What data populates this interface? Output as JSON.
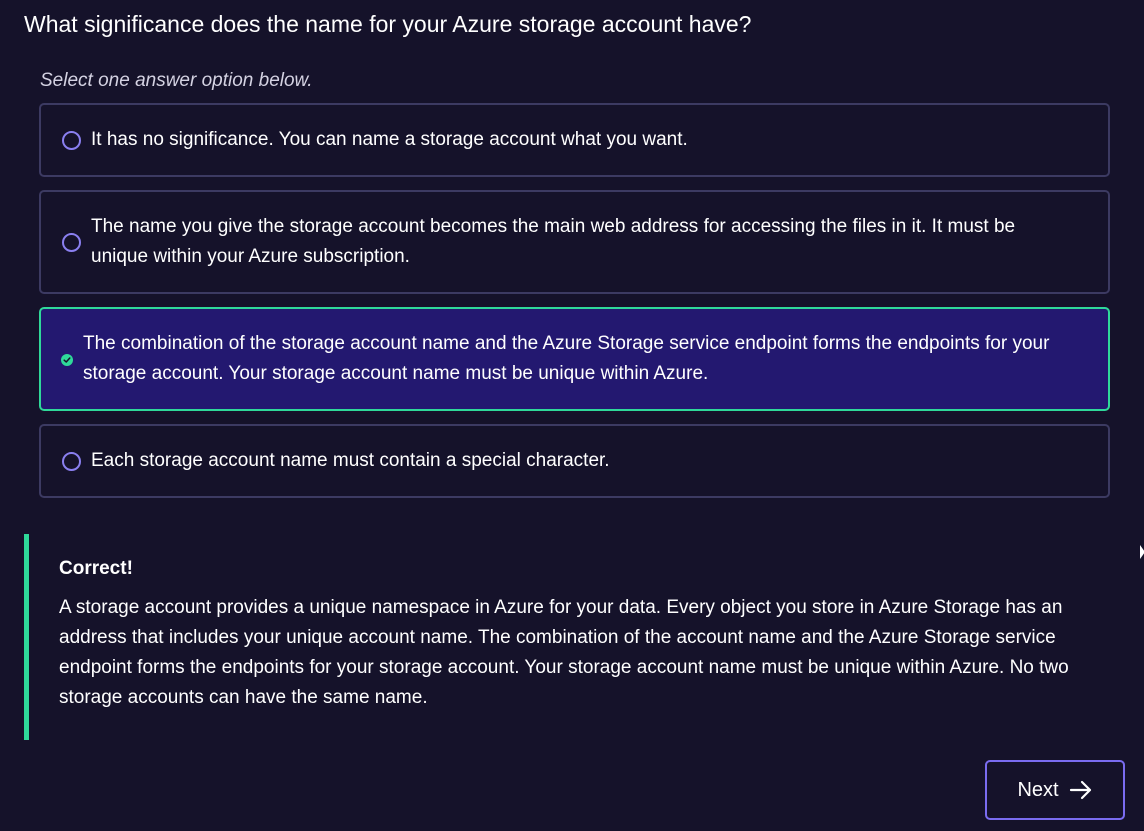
{
  "question": {
    "text": "What significance does the name for your Azure storage account have?",
    "instruction": "Select one answer option below."
  },
  "options": [
    {
      "label": "It has no significance. You can name a storage account what you want.",
      "selected": false
    },
    {
      "label": "The name you give the storage account becomes the main web address for accessing the files in it. It must be unique within your Azure subscription.",
      "selected": false
    },
    {
      "label": "The combination of the storage account name and the Azure Storage service endpoint forms the endpoints for your storage account. Your storage account name must be unique within Azure.",
      "selected": true
    },
    {
      "label": "Each storage account name must contain a special character.",
      "selected": false
    }
  ],
  "feedback": {
    "title": "Correct!",
    "body": "A storage account provides a unique namespace in Azure for your data. Every object you store in Azure Storage has an address that includes your unique account name. The combination of the account name and the Azure Storage service endpoint forms the endpoints for your storage account. Your storage account name must be unique within Azure. No two storage accounts can have the same name."
  },
  "next_button": {
    "label": "Next",
    "icon": "arrow-right-icon"
  },
  "colors": {
    "background": "#15122a",
    "option_border": "#3c3a62",
    "selected_background": "#231870",
    "correct_accent": "#2fd99a",
    "radio_border": "#8a7ff0",
    "button_border": "#7a6cf0"
  }
}
